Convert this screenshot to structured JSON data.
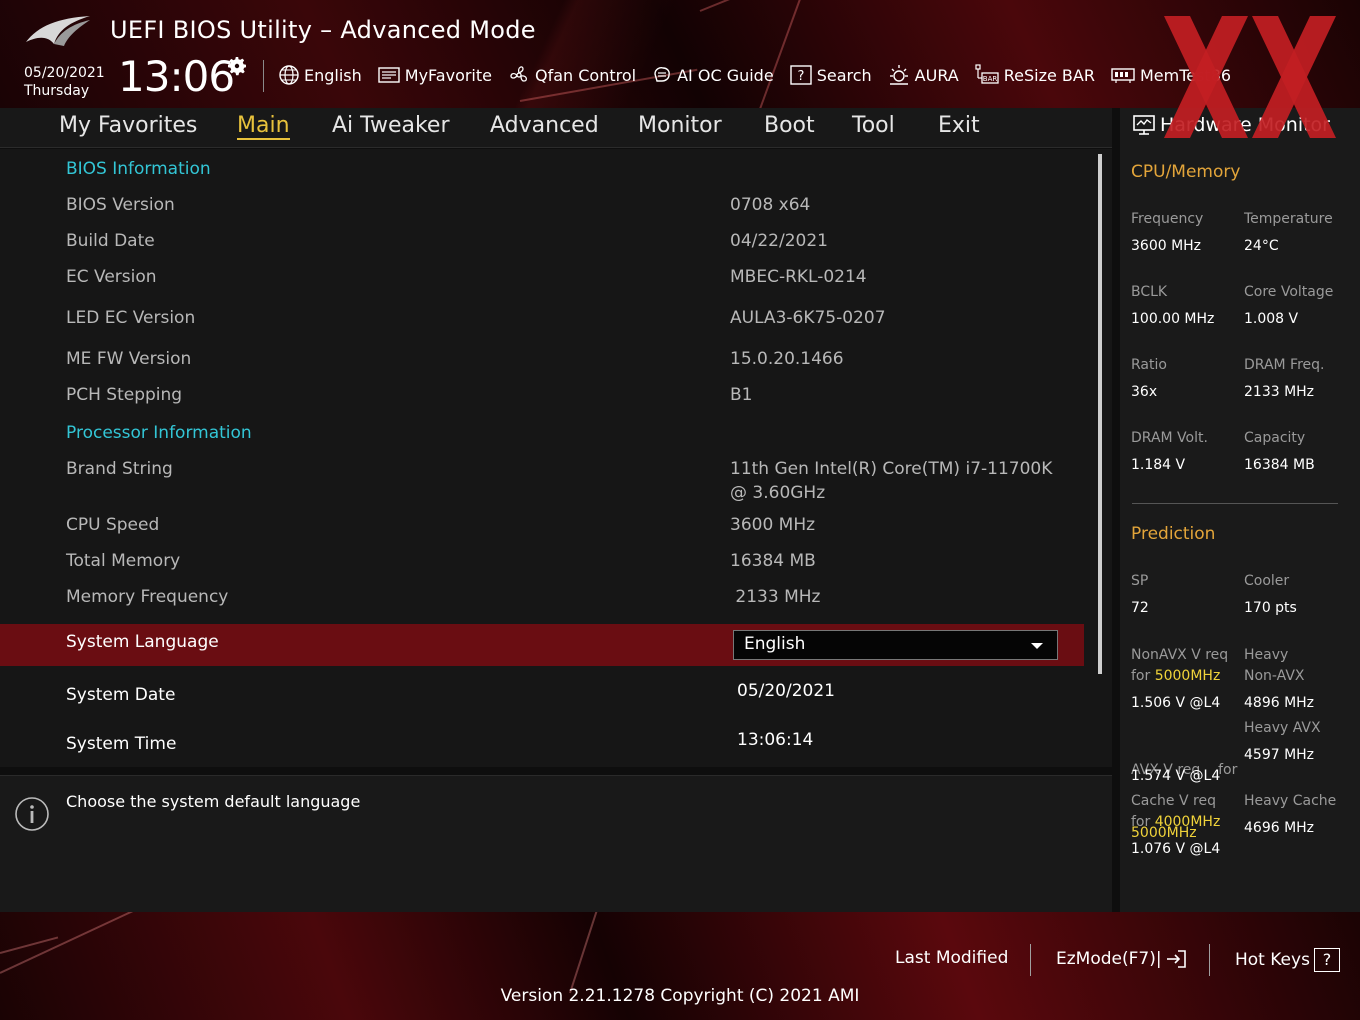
{
  "header": {
    "title": "UEFI BIOS Utility – Advanced Mode",
    "date": "05/20/2021",
    "weekday": "Thursday",
    "time": "13:06",
    "toolbar": [
      {
        "label": "English",
        "icon": "globe-icon"
      },
      {
        "label": "MyFavorite",
        "icon": "favorite-icon"
      },
      {
        "label": "Qfan Control",
        "icon": "fan-icon"
      },
      {
        "label": "AI OC Guide",
        "icon": "ai-chip-icon"
      },
      {
        "label": "Search",
        "icon": "search-icon"
      },
      {
        "label": "AURA",
        "icon": "aura-icon"
      },
      {
        "label": "ReSize BAR",
        "icon": "resize-bar-icon"
      },
      {
        "label": "MemTest86",
        "icon": "memtest-icon"
      }
    ]
  },
  "menu": {
    "items": [
      "My Favorites",
      "Main",
      "Ai Tweaker",
      "Advanced",
      "Monitor",
      "Boot",
      "Tool",
      "Exit"
    ],
    "active": "Main"
  },
  "main": {
    "bios_section": "BIOS Information",
    "bios_rows": [
      {
        "label": "BIOS Version",
        "value": "0708  x64"
      },
      {
        "label": "Build Date",
        "value": "04/22/2021"
      },
      {
        "label": "EC Version",
        "value": "MBEC-RKL-0214"
      },
      {
        "label": "LED EC Version",
        "value": "AULA3-6K75-0207"
      },
      {
        "label": "ME FW Version",
        "value": "15.0.20.1466"
      },
      {
        "label": "PCH Stepping",
        "value": "B1"
      }
    ],
    "processor_section": "Processor Information",
    "brand_string": {
      "label": "Brand String",
      "line1": "11th Gen Intel(R) Core(TM) i7-11700K",
      "line2": "@ 3.60GHz"
    },
    "proc_rows": [
      {
        "label": "CPU Speed",
        "value": "3600 MHz"
      },
      {
        "label": "Total Memory",
        "value": "16384 MB"
      },
      {
        "label": "Memory Frequency",
        "value": " 2133 MHz"
      }
    ],
    "system_language": {
      "label": "System Language",
      "value": "English"
    },
    "system_date": {
      "label": "System Date",
      "value": "05/20/2021"
    },
    "system_time": {
      "label": "System Time",
      "value": "13:06:14"
    }
  },
  "help": {
    "text": "Choose the system default language"
  },
  "hw_monitor": {
    "title": "Hardware Monitor",
    "cpu_memory": {
      "heading": "CPU/Memory",
      "items": [
        {
          "label": "Frequency",
          "value": "3600 MHz"
        },
        {
          "label": "Temperature",
          "value": "24°C"
        },
        {
          "label": "BCLK",
          "value": "100.00 MHz"
        },
        {
          "label": "Core Voltage",
          "value": "1.008 V"
        },
        {
          "label": "Ratio",
          "value": "36x"
        },
        {
          "label": "DRAM Freq.",
          "value": "2133 MHz"
        },
        {
          "label": "DRAM Volt.",
          "value": "1.184 V"
        },
        {
          "label": "Capacity",
          "value": "16384 MB"
        }
      ]
    },
    "prediction": {
      "heading": "Prediction",
      "sp_label": "SP",
      "sp_value": "72",
      "cooler_label": "Cooler",
      "cooler_value": "170 pts",
      "nonavx_label1": "NonAVX V req",
      "nonavx_label2_pre": "for ",
      "nonavx_freq": "5000MHz",
      "nonavx_value": "1.506 V @L4",
      "heavy_nonavx_label1": "Heavy",
      "heavy_nonavx_label2": "Non-AVX",
      "heavy_nonavx_value": "4896 MHz",
      "avx_label1": "AVX V req    for",
      "avx_freq": "5000MHz",
      "avx_value": "1.574 V @L4",
      "heavy_avx_label": "Heavy AVX",
      "heavy_avx_value": "4597 MHz",
      "cache_label1": "Cache V req",
      "cache_label2_pre": "for ",
      "cache_freq": "4000MHz",
      "cache_value": "1.076 V @L4",
      "heavy_cache_label": "Heavy Cache",
      "heavy_cache_value": "4696 MHz"
    }
  },
  "footer": {
    "last_modified": "Last Modified",
    "ezmode": "EzMode(F7)|",
    "hotkeys": "Hot Keys",
    "hotkeys_badge": "?",
    "version": "Version 2.21.1278 Copyright (C) 2021 AMI"
  },
  "colors": {
    "accent_gold": "#e8c23c",
    "section_cyan": "#33c6d6",
    "hwm_orange": "#e3a53a",
    "highlight_red": "#6a0d12"
  }
}
